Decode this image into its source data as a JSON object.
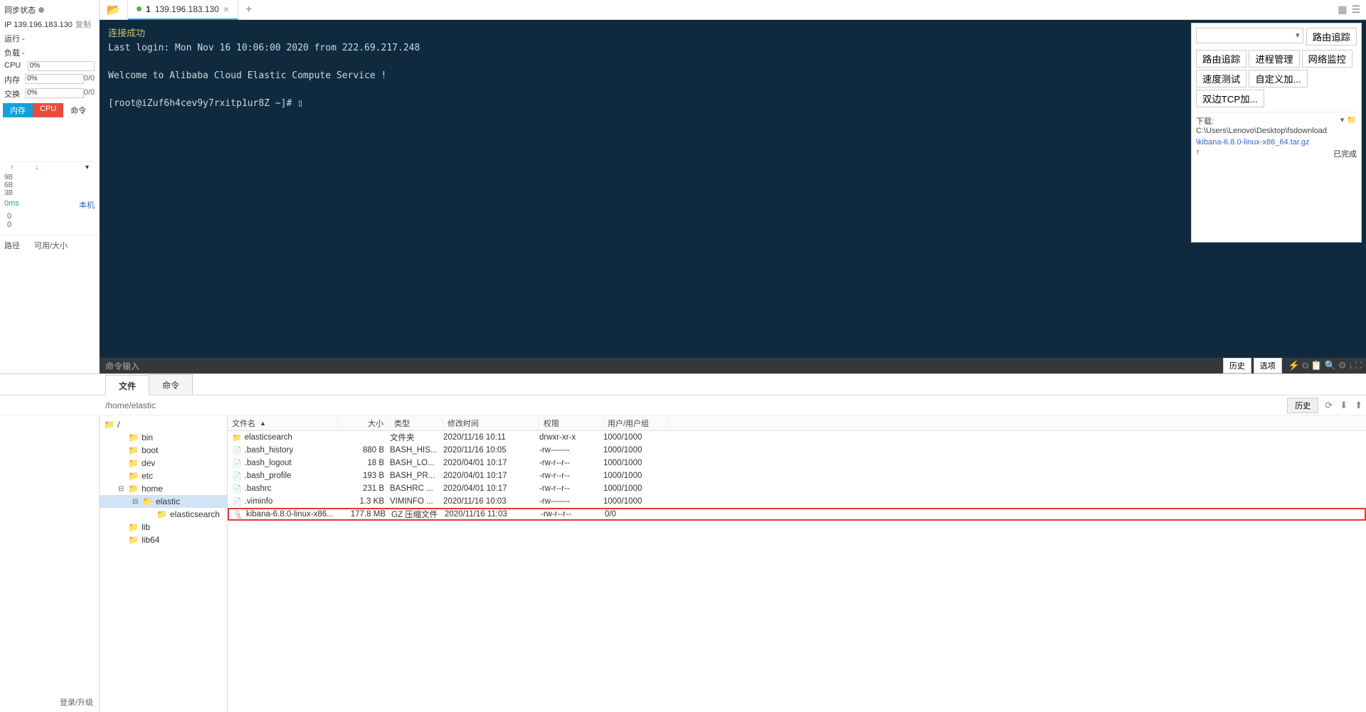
{
  "status": {
    "label": "同步状态",
    "ip_label": "IP",
    "ip": "139.196.183.130",
    "copy": "复制",
    "run": "运行 -",
    "load": "负载 -",
    "cpu": "CPU",
    "mem": "内存",
    "swap": "交换",
    "cpu_pct": "0%",
    "mem_pct": "0%",
    "swap_pct": "0%",
    "mem_frac": "0/0",
    "swap_frac": "0/0"
  },
  "tabs": {
    "mem": "内存",
    "cpu": "CPU",
    "cmd": "命令"
  },
  "net": {
    "scale": [
      "9B",
      "6B",
      "3B"
    ],
    "ms": "0ms",
    "host": "本机",
    "zeros": [
      "0",
      "0"
    ],
    "path_hdr1": "路径",
    "path_hdr2": "可用/大小"
  },
  "conn": {
    "tab_prefix": "1",
    "tab_ip": "139.196.183.130"
  },
  "terminal": {
    "line1": "连接成功",
    "line2": "Last login: Mon Nov 16 10:06:00 2020 from 222.69.217.248",
    "line3": "Welcome to Alibaba Cloud Elastic Compute Service !",
    "prompt": "[root@iZuf6h4cev9y7rxitp1ur8Z ~]# ",
    "cursor": "▯",
    "input_placeholder": "命令输入",
    "btn_history": "历史",
    "btn_options": "选项"
  },
  "rpanel": {
    "trace": "路由追踪",
    "btns": [
      "路由追踪",
      "进程管理",
      "网络监控",
      "速度测试",
      "自定义加...",
      "双边TCP加..."
    ],
    "dl_label": "下载:",
    "dl_path": "C:\\Users\\Lenovo\\Desktop\\fsdownload",
    "file": "\\kibana-6.8.0-linux-x86_64.tar.gz",
    "done": "已完成"
  },
  "btabs": {
    "file": "文件",
    "cmd": "命令"
  },
  "bpath": {
    "value": "/home/elastic",
    "history": "历史"
  },
  "tree": {
    "root": "/",
    "items": [
      "bin",
      "boot",
      "dev",
      "etc",
      "home",
      "elastic",
      "elasticsearch",
      "lib",
      "lib64"
    ]
  },
  "fl_headers": {
    "name": "文件名",
    "size": "大小",
    "type": "类型",
    "mtime": "修改时间",
    "perm": "权限",
    "user": "用户/用户组"
  },
  "files": [
    {
      "icon": "folder",
      "name": "elasticsearch",
      "size": "",
      "type": "文件夹",
      "mtime": "2020/11/16 10:11",
      "perm": "drwxr-xr-x",
      "user": "1000/1000"
    },
    {
      "icon": "file",
      "name": ".bash_history",
      "size": "880 B",
      "type": "BASH_HIS...",
      "mtime": "2020/11/16 10:05",
      "perm": "-rw-------",
      "user": "1000/1000"
    },
    {
      "icon": "file",
      "name": ".bash_logout",
      "size": "18 B",
      "type": "BASH_LO...",
      "mtime": "2020/04/01 10:17",
      "perm": "-rw-r--r--",
      "user": "1000/1000"
    },
    {
      "icon": "file",
      "name": ".bash_profile",
      "size": "193 B",
      "type": "BASH_PR...",
      "mtime": "2020/04/01 10:17",
      "perm": "-rw-r--r--",
      "user": "1000/1000"
    },
    {
      "icon": "file",
      "name": ".bashrc",
      "size": "231 B",
      "type": "BASHRC ...",
      "mtime": "2020/04/01 10:17",
      "perm": "-rw-r--r--",
      "user": "1000/1000"
    },
    {
      "icon": "file",
      "name": ".viminfo",
      "size": "1.3 KB",
      "type": "VIMINFO ...",
      "mtime": "2020/11/16 10:03",
      "perm": "-rw-------",
      "user": "1000/1000"
    },
    {
      "icon": "gz",
      "name": "kibana-6.8.0-linux-x86...",
      "size": "177.8 MB",
      "type": "GZ 压缩文件",
      "mtime": "2020/11/16 11:03",
      "perm": "-rw-r--r--",
      "user": "0/0",
      "hl": true
    }
  ],
  "login": "登录/升级"
}
